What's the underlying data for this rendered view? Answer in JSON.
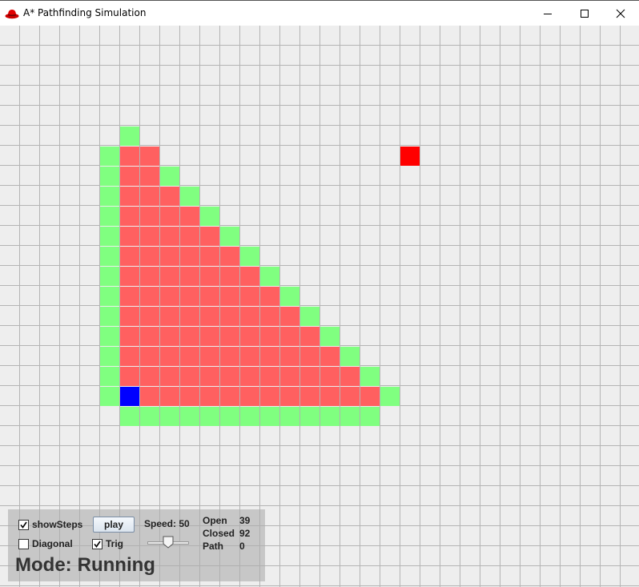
{
  "window": {
    "title": "A* Pathfinding Simulation",
    "icon": "red-hat-icon",
    "controls": [
      "minimize-icon",
      "maximize-icon",
      "close-icon"
    ]
  },
  "grid": {
    "cell_size": 25,
    "columns": 32,
    "rows": 28,
    "colors": {
      "background": "#eeeeee",
      "grid_line": "#b4b4b4",
      "open": "#80ff80",
      "closed": "#ff6060",
      "start": "#0000ff",
      "goal": "#ff0000"
    },
    "start": [
      6,
      18
    ],
    "goal": [
      20,
      6
    ],
    "closed_cells": [
      [
        6,
        6
      ],
      [
        7,
        6
      ],
      [
        6,
        7
      ],
      [
        7,
        7
      ],
      [
        6,
        8
      ],
      [
        7,
        8
      ],
      [
        8,
        8
      ],
      [
        6,
        9
      ],
      [
        7,
        9
      ],
      [
        8,
        9
      ],
      [
        9,
        9
      ],
      [
        6,
        10
      ],
      [
        7,
        10
      ],
      [
        8,
        10
      ],
      [
        9,
        10
      ],
      [
        10,
        10
      ],
      [
        6,
        11
      ],
      [
        7,
        11
      ],
      [
        8,
        11
      ],
      [
        9,
        11
      ],
      [
        10,
        11
      ],
      [
        11,
        11
      ],
      [
        6,
        12
      ],
      [
        7,
        12
      ],
      [
        8,
        12
      ],
      [
        9,
        12
      ],
      [
        10,
        12
      ],
      [
        11,
        12
      ],
      [
        12,
        12
      ],
      [
        6,
        13
      ],
      [
        7,
        13
      ],
      [
        8,
        13
      ],
      [
        9,
        13
      ],
      [
        10,
        13
      ],
      [
        11,
        13
      ],
      [
        12,
        13
      ],
      [
        13,
        13
      ],
      [
        6,
        14
      ],
      [
        7,
        14
      ],
      [
        8,
        14
      ],
      [
        9,
        14
      ],
      [
        10,
        14
      ],
      [
        11,
        14
      ],
      [
        12,
        14
      ],
      [
        13,
        14
      ],
      [
        14,
        14
      ],
      [
        6,
        15
      ],
      [
        7,
        15
      ],
      [
        8,
        15
      ],
      [
        9,
        15
      ],
      [
        10,
        15
      ],
      [
        11,
        15
      ],
      [
        12,
        15
      ],
      [
        13,
        15
      ],
      [
        14,
        15
      ],
      [
        15,
        15
      ],
      [
        6,
        16
      ],
      [
        7,
        16
      ],
      [
        8,
        16
      ],
      [
        9,
        16
      ],
      [
        10,
        16
      ],
      [
        11,
        16
      ],
      [
        12,
        16
      ],
      [
        13,
        16
      ],
      [
        14,
        16
      ],
      [
        15,
        16
      ],
      [
        16,
        16
      ],
      [
        6,
        17
      ],
      [
        7,
        17
      ],
      [
        8,
        17
      ],
      [
        9,
        17
      ],
      [
        10,
        17
      ],
      [
        11,
        17
      ],
      [
        12,
        17
      ],
      [
        13,
        17
      ],
      [
        14,
        17
      ],
      [
        15,
        17
      ],
      [
        16,
        17
      ],
      [
        17,
        17
      ],
      [
        7,
        18
      ],
      [
        8,
        18
      ],
      [
        9,
        18
      ],
      [
        10,
        18
      ],
      [
        11,
        18
      ],
      [
        12,
        18
      ],
      [
        13,
        18
      ],
      [
        14,
        18
      ],
      [
        15,
        18
      ],
      [
        16,
        18
      ],
      [
        17,
        18
      ],
      [
        18,
        18
      ]
    ],
    "open_cells": [
      [
        6,
        5
      ],
      [
        5,
        6
      ],
      [
        5,
        7
      ],
      [
        5,
        8
      ],
      [
        5,
        9
      ],
      [
        5,
        10
      ],
      [
        5,
        11
      ],
      [
        5,
        12
      ],
      [
        5,
        13
      ],
      [
        5,
        14
      ],
      [
        5,
        15
      ],
      [
        5,
        16
      ],
      [
        5,
        17
      ],
      [
        5,
        18
      ],
      [
        8,
        7
      ],
      [
        9,
        8
      ],
      [
        10,
        9
      ],
      [
        11,
        10
      ],
      [
        12,
        11
      ],
      [
        13,
        12
      ],
      [
        14,
        13
      ],
      [
        15,
        14
      ],
      [
        16,
        15
      ],
      [
        17,
        16
      ],
      [
        18,
        17
      ],
      [
        19,
        18
      ],
      [
        6,
        19
      ],
      [
        7,
        19
      ],
      [
        8,
        19
      ],
      [
        9,
        19
      ],
      [
        10,
        19
      ],
      [
        11,
        19
      ],
      [
        12,
        19
      ],
      [
        13,
        19
      ],
      [
        14,
        19
      ],
      [
        15,
        19
      ],
      [
        16,
        19
      ],
      [
        17,
        19
      ],
      [
        18,
        19
      ]
    ]
  },
  "panel": {
    "show_steps": {
      "label": "showSteps",
      "checked": true
    },
    "diagonal": {
      "label": "Diagonal",
      "checked": false
    },
    "trig": {
      "label": "Trig",
      "checked": true
    },
    "play_label": "play",
    "speed_label": "Speed:",
    "speed_value": "50",
    "speed": 50,
    "stats": [
      {
        "label": "Open",
        "value": "39"
      },
      {
        "label": "Closed",
        "value": "92"
      },
      {
        "label": "Path",
        "value": "0"
      }
    ],
    "mode_label": "Mode:",
    "mode_value": "Running"
  }
}
